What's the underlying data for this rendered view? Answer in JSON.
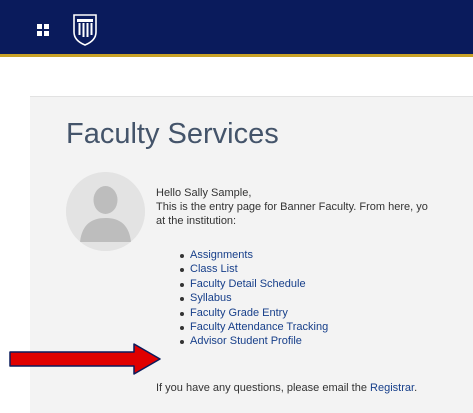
{
  "header": {
    "apps_icon": "apps-grid-icon",
    "logo_icon": "university-seal-logo",
    "colors": {
      "bar": "#0a1b5c",
      "accent": "#c9a227"
    }
  },
  "page": {
    "title": "Faculty Services"
  },
  "profile": {
    "avatar_icon": "user-silhouette-icon"
  },
  "intro": {
    "greeting": "Hello Sally Sample,",
    "line1": "This is the entry page for Banner Faculty. From here, yo",
    "line2": "at the institution:"
  },
  "links": [
    {
      "label": "Assignments"
    },
    {
      "label": "Class List"
    },
    {
      "label": "Faculty Detail Schedule"
    },
    {
      "label": "Syllabus"
    },
    {
      "label": "Faculty Grade Entry"
    },
    {
      "label": "Faculty Attendance Tracking"
    },
    {
      "label": "Advisor Student Profile"
    }
  ],
  "annotation": {
    "arrow_icon": "red-arrow-icon",
    "color": "#e00000"
  },
  "footer": {
    "prefix": "If you have any questions, please email the ",
    "link": "Registrar",
    "suffix": "."
  }
}
